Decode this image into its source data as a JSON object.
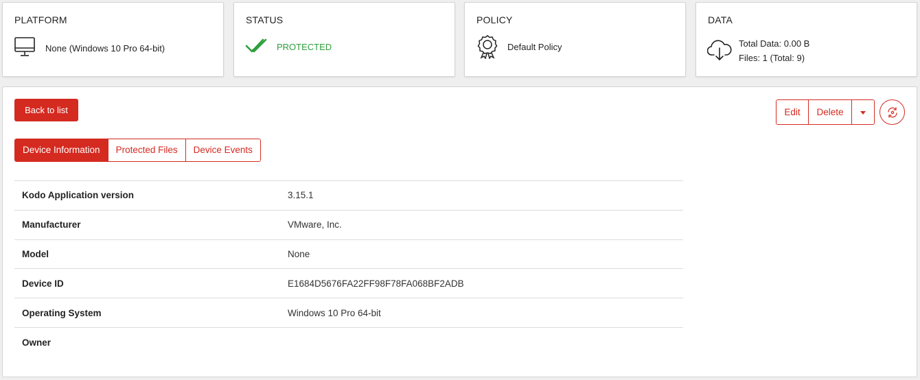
{
  "cards": {
    "platform": {
      "title": "PLATFORM",
      "value": "None (Windows 10 Pro 64-bit)",
      "icon": "monitor-icon"
    },
    "status": {
      "title": "STATUS",
      "value": "PROTECTED",
      "icon": "double-check-icon",
      "color": "#2e9e3c"
    },
    "policy": {
      "title": "POLICY",
      "value": "Default Policy",
      "icon": "badge-icon"
    },
    "data": {
      "title": "DATA",
      "total_data": "Total Data: 0.00 B",
      "files": "Files: 1 (Total: 9)",
      "icon": "cloud-icon"
    }
  },
  "toolbar": {
    "back_label": "Back to list",
    "edit_label": "Edit",
    "delete_label": "Delete",
    "more_icon": "caret-down-icon",
    "circle_icon": "refresh-icon"
  },
  "tabs": [
    {
      "label": "Device Information",
      "active": true
    },
    {
      "label": "Protected Files",
      "active": false
    },
    {
      "label": "Device Events",
      "active": false
    }
  ],
  "device_info": [
    {
      "key": "Kodo Application version",
      "value": "3.15.1"
    },
    {
      "key": "Manufacturer",
      "value": "VMware, Inc."
    },
    {
      "key": "Model",
      "value": "None"
    },
    {
      "key": "Device ID",
      "value": "E1684D5676FA22FF98F78FA068BF2ADB"
    },
    {
      "key": "Operating System",
      "value": "Windows 10 Pro 64-bit"
    },
    {
      "key": "Owner",
      "value": ""
    }
  ],
  "colors": {
    "accent": "#d42a20",
    "success": "#2e9e3c"
  }
}
